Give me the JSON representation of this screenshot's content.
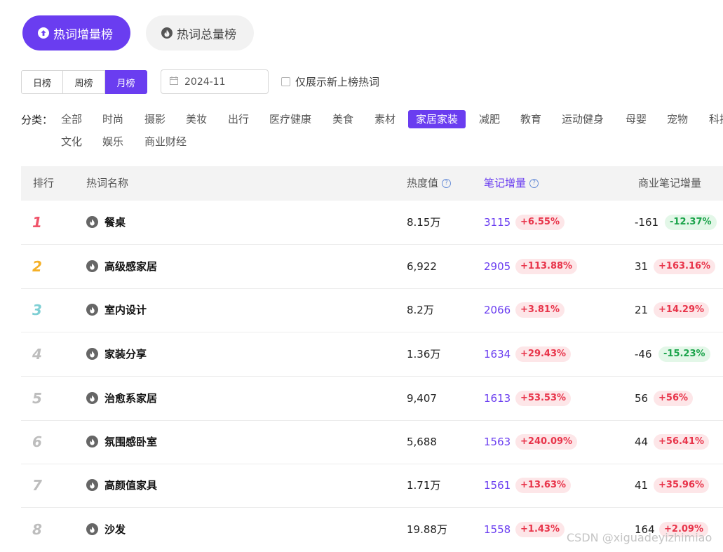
{
  "top_tabs": [
    {
      "label": "热词增量榜",
      "active": true,
      "icon": "arrow-up-circle-icon"
    },
    {
      "label": "热词总量榜",
      "active": false,
      "icon": "flame-icon"
    }
  ],
  "period_tabs": [
    {
      "label": "日榜",
      "active": false
    },
    {
      "label": "周榜",
      "active": false
    },
    {
      "label": "月榜",
      "active": true
    }
  ],
  "date_picker": {
    "value": "2024-11",
    "icon": "calendar-icon"
  },
  "new_only_checkbox": {
    "label": "仅展示新上榜热词",
    "checked": false
  },
  "categories": {
    "label": "分类：",
    "selected": "家居家装",
    "items": [
      "全部",
      "时尚",
      "摄影",
      "美妆",
      "出行",
      "医疗健康",
      "美食",
      "素材",
      "家居家装",
      "减肥",
      "教育",
      "运动健身",
      "母婴",
      "宠物",
      "科技",
      "文化",
      "娱乐",
      "商业财经"
    ]
  },
  "table": {
    "headers": {
      "rank": "排行",
      "keyword": "热词名称",
      "heat": "热度值",
      "note_increase": "笔记增量",
      "biz_note_increase": "商业笔记增量"
    },
    "rows": [
      {
        "rank": "1",
        "keyword": "餐桌",
        "heat": "8.15万",
        "note_inc": "3115",
        "note_pct": "+6.55%",
        "biz_inc": "-161",
        "biz_pct": "-12.37%"
      },
      {
        "rank": "2",
        "keyword": "高级感家居",
        "heat": "6,922",
        "note_inc": "2905",
        "note_pct": "+113.88%",
        "biz_inc": "31",
        "biz_pct": "+163.16%"
      },
      {
        "rank": "3",
        "keyword": "室内设计",
        "heat": "8.2万",
        "note_inc": "2066",
        "note_pct": "+3.81%",
        "biz_inc": "21",
        "biz_pct": "+14.29%"
      },
      {
        "rank": "4",
        "keyword": "家装分享",
        "heat": "1.36万",
        "note_inc": "1634",
        "note_pct": "+29.43%",
        "biz_inc": "-46",
        "biz_pct": "-15.23%"
      },
      {
        "rank": "5",
        "keyword": "治愈系家居",
        "heat": "9,407",
        "note_inc": "1613",
        "note_pct": "+53.53%",
        "biz_inc": "56",
        "biz_pct": "+56%"
      },
      {
        "rank": "6",
        "keyword": "氛围感卧室",
        "heat": "5,688",
        "note_inc": "1563",
        "note_pct": "+240.09%",
        "biz_inc": "44",
        "biz_pct": "+56.41%"
      },
      {
        "rank": "7",
        "keyword": "高颜值家具",
        "heat": "1.71万",
        "note_inc": "1561",
        "note_pct": "+13.63%",
        "biz_inc": "41",
        "biz_pct": "+35.96%"
      },
      {
        "rank": "8",
        "keyword": "沙发",
        "heat": "19.88万",
        "note_inc": "1558",
        "note_pct": "+1.43%",
        "biz_inc": "164",
        "biz_pct": "+2.09%"
      }
    ]
  },
  "colors": {
    "accent": "#6a3df0",
    "rank1": "#f0546a",
    "rank2": "#f5b027",
    "rank3": "#7ecfd4",
    "rank_other": "#bdbdbd",
    "up": "#e8344a",
    "down": "#1aa34a"
  },
  "watermark": "CSDN @xiguadeyizhimiao"
}
